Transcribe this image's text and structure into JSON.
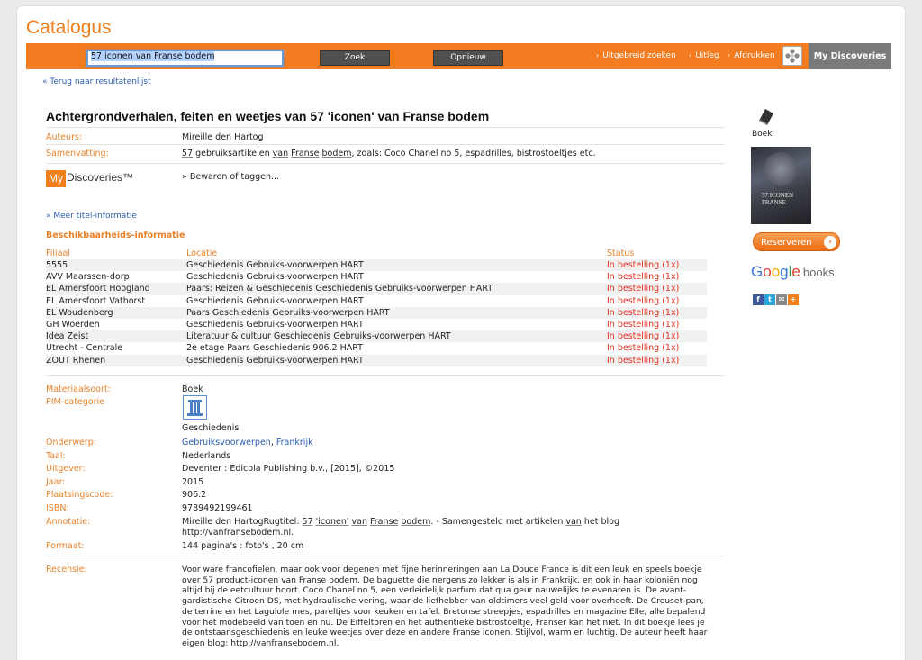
{
  "app_title": "Catalogus",
  "search": {
    "value": "57 iconen van Franse bodem",
    "search_button": "Zoek",
    "reset_button": "Opnieuw"
  },
  "top_links": {
    "advanced": "Uitgebreid zoeken",
    "help": "Uitleg",
    "print": "Afdrukken",
    "my_discoveries": "My Discoveries"
  },
  "back_link": "« Terug naar resultatenlijst",
  "record": {
    "title_parts": [
      "Achtergrondverhalen, feiten en weetjes ",
      "van",
      " ",
      "57",
      " ",
      "'iconen'",
      " ",
      "van",
      " ",
      "Franse",
      " ",
      "bodem"
    ],
    "authors_label": "Auteurs:",
    "authors_value": "Mireille den Hartog",
    "summary_label": "Samenvatting:",
    "summary_parts": [
      "57",
      " gebruiksartikelen ",
      "van",
      " ",
      "Franse",
      " ",
      "bodem",
      ", zoals: Coco Chanel no 5, espadrilles, bistrostoeltjes etc."
    ],
    "mydiscoveries_logo_my": "My",
    "mydiscoveries_logo_rest": "Discoveries™",
    "save_tag_link": "» Bewaren of taggen...",
    "more_info_link": "» Meer titel-informatie"
  },
  "availability": {
    "heading": "Beschikbaarheids-informatie",
    "columns": [
      "Filiaal",
      "Locatie",
      "Status"
    ],
    "rows": [
      {
        "branch": "5555",
        "location": "Geschiedenis Gebruiks-voorwerpen HART",
        "status": "In bestelling (1x)"
      },
      {
        "branch": "AVV Maarssen-dorp",
        "location": "Geschiedenis Gebruiks-voorwerpen HART",
        "status": "In bestelling (1x)"
      },
      {
        "branch": "EL Amersfoort Hoogland",
        "location": "Paars: Reizen & Geschiedenis Geschiedenis Gebruiks-voorwerpen HART",
        "status": "In bestelling (1x)"
      },
      {
        "branch": "EL Amersfoort Vathorst",
        "location": "Geschiedenis Gebruiks-voorwerpen HART",
        "status": "In bestelling (1x)"
      },
      {
        "branch": "EL Woudenberg",
        "location": "Paars Geschiedenis Gebruiks-voorwerpen HART",
        "status": "In bestelling (1x)"
      },
      {
        "branch": "GH Woerden",
        "location": "Geschiedenis Gebruiks-voorwerpen HART",
        "status": "In bestelling (1x)"
      },
      {
        "branch": "Idea Zeist",
        "location": "Literatuur & cultuur Geschiedenis Gebruiks-voorwerpen HART",
        "status": "In bestelling (1x)"
      },
      {
        "branch": "Utrecht - Centrale",
        "location": "2e etage Paars Geschiedenis 906.2 HART",
        "status": "In bestelling (1x)"
      },
      {
        "branch": "ZOUT Rhenen",
        "location": "Geschiedenis Gebruiks-voorwerpen HART",
        "status": "In bestelling (1x)"
      }
    ]
  },
  "details": {
    "material_label": "Materiaalsoort:",
    "material_value": "Boek",
    "pim_label": "PIM-categorie",
    "pim_value": "Geschiedenis",
    "subject_label": "Onderwerp:",
    "subject_1": "Gebruiksvoorwerpen",
    "subject_sep": ", ",
    "subject_2": "Frankrijk",
    "language_label": "Taal:",
    "language_value": "Nederlands",
    "publisher_label": "Uitgever:",
    "publisher_value": "Deventer : Edicola Publishing b.v., [2015], ©2015",
    "year_label": "Jaar:",
    "year_value": "2015",
    "shelf_label": "Plaatsingscode:",
    "shelf_value": "906.2",
    "isbn_label": "ISBN:",
    "isbn_value": "9789492199461",
    "annotation_label": "Annotatie:",
    "annotation_parts": [
      "Mireille den HartogRugtitel: ",
      "57",
      " ",
      "'iconen'",
      " ",
      "van",
      " ",
      "Franse",
      " ",
      "bodem",
      ". - Samengesteld met artikelen ",
      "van",
      " het blog"
    ],
    "annotation_line2": "http://vanfransebodem.nl.",
    "format_label": "Formaat:",
    "format_value": "144 pagina's : foto's , 20 cm",
    "review_label": "Recensie:",
    "review_lines": [
      "Voor ware francofielen, maar ook voor degenen met fijne herinneringen aan La Douce France is dit een leuk en speels boekje",
      "over 57 product-iconen van Franse bodem. De baguette die nergens zo lekker is als in Frankrijk, en ook in haar koloniën nog",
      "altijd bij de eetcultuur hoort. Coco Chanel no 5, een verleidelijk parfum dat qua geur nauwelijks te evenaren is. De avant-",
      "gardistische Citroen DS, met hydraulische vering, waar de liefhebber van oldtimers veel geld voor overheeft. De Creuset-pan,",
      "de terrine en het Laguiole mes, pareltjes voor keuken en tafel. Bretonse streepjes, espadrilles en magazine Elle, alle bepalend",
      "voor het modebeeld van toen en nu. De Eiffeltoren en het authentieke bistrostoeltje, Franser kan het niet. In dit boekje lees je",
      "de ontstaansgeschiedenis en leuke weetjes over deze en andere Franse iconen. Stijlvol, warm en luchtig. De auteur heeft haar",
      "eigen blog: http://vanfransebodem.nl."
    ]
  },
  "sidebar": {
    "type_label": "Boek",
    "cover_line1": "57 ICONEN",
    "cover_line2": "FRANSE",
    "reserve_button": "Reserveren",
    "google_books": "books",
    "share_icons": [
      "f",
      "t",
      "✉",
      "+"
    ]
  },
  "colors": {
    "accent": "#f47c20",
    "label": "#e8822a",
    "link": "#2a5db0",
    "status": "#e0301e",
    "tab": "#7a7a7a"
  },
  "icons": [
    "print-icon",
    "book-icon",
    "pim-history-icon",
    "facebook-icon",
    "twitter-icon",
    "mail-icon",
    "add-icon"
  ]
}
